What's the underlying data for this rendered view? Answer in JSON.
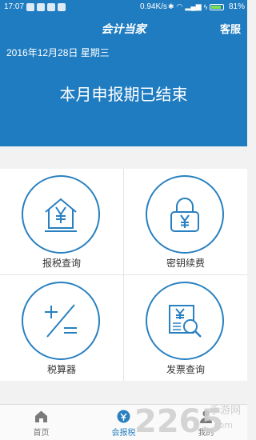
{
  "status_bar": {
    "time": "17:07",
    "speed": "0.94K/s",
    "battery": "81%"
  },
  "header": {
    "title": "会计当家",
    "service_label": "客服"
  },
  "banner": {
    "date": "2016年12月28日 星期三",
    "status": "本月申报期已结束"
  },
  "features": [
    {
      "label": "报税查询",
      "icon": "house-yuan-icon"
    },
    {
      "label": "密钥续费",
      "icon": "lock-yuan-icon"
    },
    {
      "label": "税算器",
      "icon": "calculator-icon"
    },
    {
      "label": "发票查询",
      "icon": "invoice-search-icon"
    }
  ],
  "tabs": [
    {
      "label": "首页",
      "icon": "home-icon",
      "active": false
    },
    {
      "label": "会报税",
      "icon": "tax-icon",
      "active": true
    },
    {
      "label": "我的",
      "icon": "user-icon",
      "active": false
    }
  ],
  "watermark": {
    "text": "2265",
    "suffix": "手游网",
    "domain": ".com"
  },
  "colors": {
    "brand": "#1f7cc0",
    "icon_stroke": "#2880c0"
  }
}
